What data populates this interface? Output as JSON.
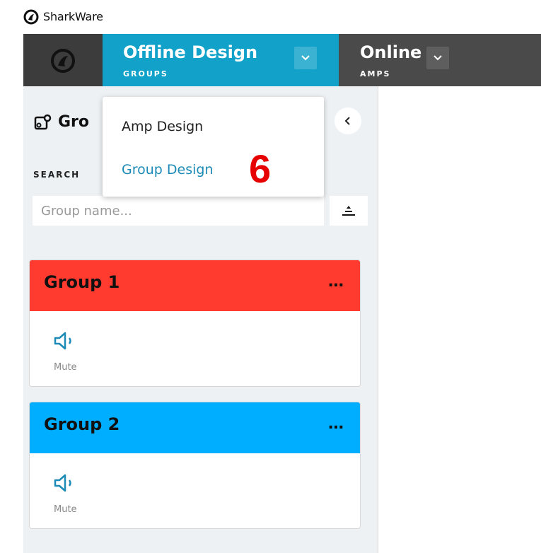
{
  "window": {
    "title": "SharkWare"
  },
  "nav": {
    "tabs": [
      {
        "title": "Offline Design",
        "subtitle": "GROUPS"
      },
      {
        "title": "Online",
        "subtitle": "AMPS"
      }
    ]
  },
  "dropdown": {
    "items": [
      {
        "label": "Amp Design"
      },
      {
        "label": "Group Design"
      }
    ]
  },
  "annotation": {
    "text": "6"
  },
  "panel": {
    "header": "Gro",
    "search": {
      "label": "SEARCH",
      "placeholder": "Group name...",
      "value": ""
    }
  },
  "groups": [
    {
      "name": "Group 1",
      "more": "…",
      "mute_label": "Mute",
      "color": "#ff3a2e"
    },
    {
      "name": "Group 2",
      "more": "…",
      "mute_label": "Mute",
      "color": "#00aeff"
    }
  ],
  "colors": {
    "accent": "#12a2c9",
    "nav_bg": "#4a4a4a",
    "active_link": "#1d8bb5"
  }
}
